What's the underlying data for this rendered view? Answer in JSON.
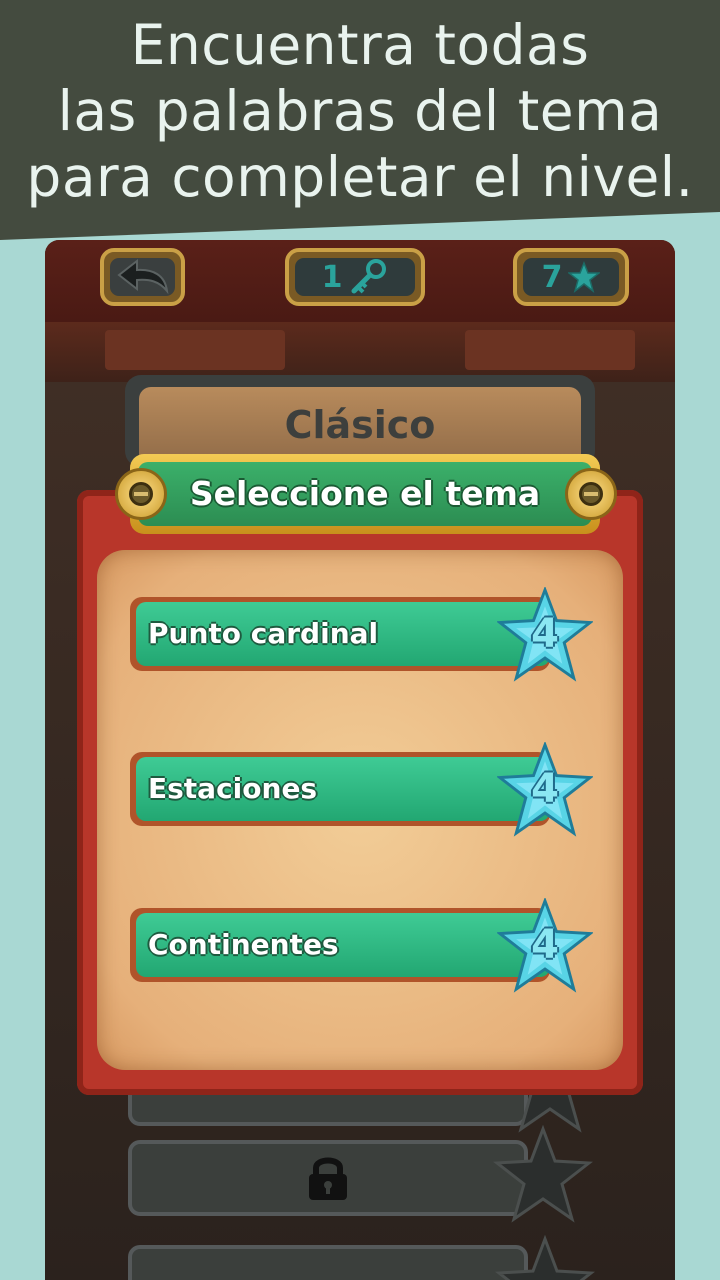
{
  "promo": {
    "line1": "Encuentra todas",
    "line2": "las palabras del tema",
    "line3": "para completar el nivel."
  },
  "hud": {
    "back_icon": "back-arrow-icon",
    "keys_count": "1",
    "key_icon": "key-icon",
    "stars_count": "7",
    "star_icon": "star-icon"
  },
  "mode": {
    "title": "Clásico"
  },
  "modal": {
    "title": "Seleccione el tema",
    "themes": [
      {
        "label": "Punto cardinal",
        "stars": "4"
      },
      {
        "label": "Estaciones",
        "stars": "4"
      },
      {
        "label": "Continentes",
        "stars": "4"
      }
    ]
  },
  "locked": {
    "icon": "padlock-icon"
  },
  "colors": {
    "banner_bg": "#444b3f",
    "background": "#a9d8d3",
    "button_green": "#2fb67e",
    "modal_red": "#b8362a",
    "star_cyan": "#58d4e6"
  }
}
